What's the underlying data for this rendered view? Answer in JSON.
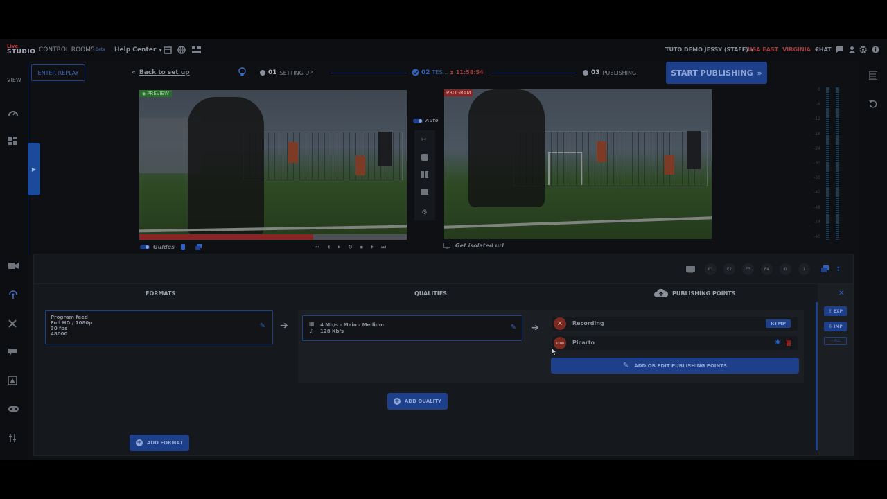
{
  "header": {
    "logo_top": "Live",
    "logo_bottom": "STUDIO",
    "control_rooms": "CONTROL ROOMS",
    "badge": "Beta",
    "help_center": "Help Center",
    "user": "TUTO DEMO JESSY (STAFF)",
    "region": "USA EAST",
    "zone": "VIRGINIA",
    "chat": "CHAT"
  },
  "left_nav": {
    "view_label": "VIEW"
  },
  "topbar": {
    "enter_replay": "ENTER REPLAY",
    "back_to_setup": "Back to set up",
    "step1_num": "01",
    "step1_label": "SETTING UP",
    "step2_num": "02",
    "step2_label": "TES...",
    "step2_timer": "11:58:54",
    "step3_num": "03",
    "step3_label": "PUBLISHING",
    "start_publishing": "START PUBLISHING"
  },
  "preview": {
    "tag": "PREVIEW",
    "progress": 0.65,
    "guides_label": "Guides"
  },
  "switcher": {
    "auto_label": "Auto"
  },
  "program": {
    "tag": "PROGRAM",
    "isolated_url": "Get isolated url"
  },
  "audio_meter_ticks": [
    "0",
    "-6",
    "-12",
    "-18",
    "-24",
    "-30",
    "-36",
    "-42",
    "-48",
    "-54",
    "-60"
  ],
  "toolbar_fkeys": [
    "F1",
    "F2",
    "F3",
    "F4",
    "0",
    "1"
  ],
  "panel": {
    "formats_header": "FORMATS",
    "qualities_header": "QUALITIES",
    "publishing_header": "PUBLISHING POINTS",
    "format": {
      "line1": "Program feed",
      "line2": "Full HD / 1080p",
      "line3": "30 fps",
      "line4": "48000"
    },
    "quality": {
      "line1": "4 Mb/s - Main - Medium",
      "line2": "128 Kb/s"
    },
    "publishing_points": [
      {
        "name": "Recording",
        "badge": "RTMP"
      },
      {
        "name": "Picarto",
        "stop": "STOP"
      }
    ],
    "add_or_edit_points": "ADD OR EDIT PUBLISHING POINTS",
    "add_quality": "ADD QUALITY",
    "add_format": "ADD FORMAT",
    "exp": "EXP",
    "imp": "IMP",
    "more": "+ ALL"
  }
}
